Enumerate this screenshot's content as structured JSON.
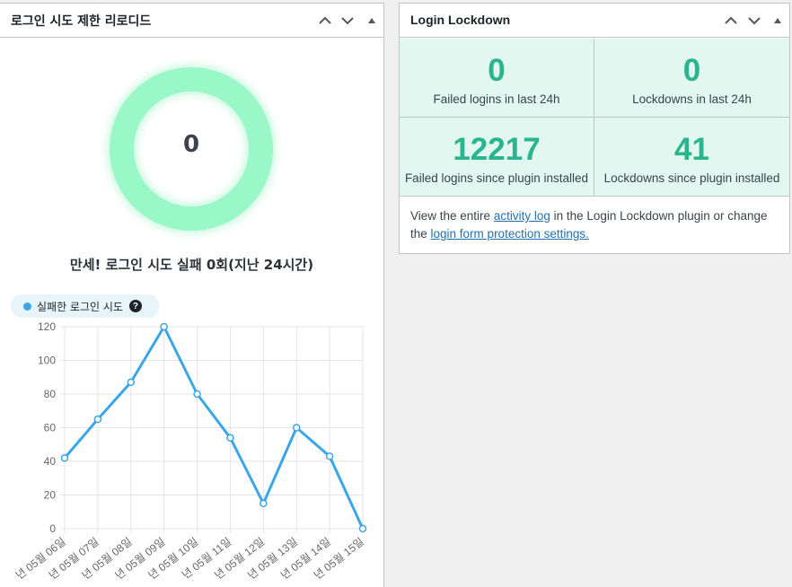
{
  "left_widget": {
    "title": "로그인 시도 제한 리로디드",
    "donut_value": "0",
    "summary": "만세! 로그인 시도 실패 0회(지난 24시간)",
    "legend_label": "실패한 로그인 시도",
    "help_glyph": "?"
  },
  "right_widget": {
    "title": "Login Lockdown",
    "stats": [
      {
        "value": "0",
        "label": "Failed logins in last 24h"
      },
      {
        "value": "0",
        "label": "Lockdowns in last 24h"
      },
      {
        "value": "12217",
        "label": "Failed logins since plugin installed"
      },
      {
        "value": "41",
        "label": "Lockdowns since plugin installed"
      }
    ],
    "footer": {
      "text_before": "View the entire ",
      "link1": "activity log",
      "text_middle": " in the Login Lockdown plugin or change the ",
      "link2": "login form protection settings."
    }
  },
  "icons": [
    "chevron-up-icon",
    "chevron-down-icon",
    "toggle-arrow-icon",
    "help-icon"
  ],
  "colors": {
    "accent_green": "#2bb58e",
    "stat_bg": "#e1f7ef",
    "donut": "#99f7c8",
    "line": "#3aa6e8",
    "link": "#2271b1"
  },
  "chart_data": {
    "type": "line",
    "categories": [
      "년 05월 06일",
      "년 05월 07일",
      "년 05월 08일",
      "년 05월 09일",
      "년 05월 10일",
      "년 05월 11일",
      "년 05월 12일",
      "년 05월 13일",
      "년 05월 14일",
      "년 05월 15일"
    ],
    "series": [
      {
        "name": "실패한 로그인 시도",
        "values": [
          42,
          65,
          87,
          120,
          80,
          54,
          15,
          60,
          43,
          0
        ]
      }
    ],
    "ylim": [
      0,
      120
    ],
    "yticks": [
      0,
      20,
      40,
      60,
      80,
      100,
      120
    ],
    "grid": true,
    "legend": "top-left"
  }
}
